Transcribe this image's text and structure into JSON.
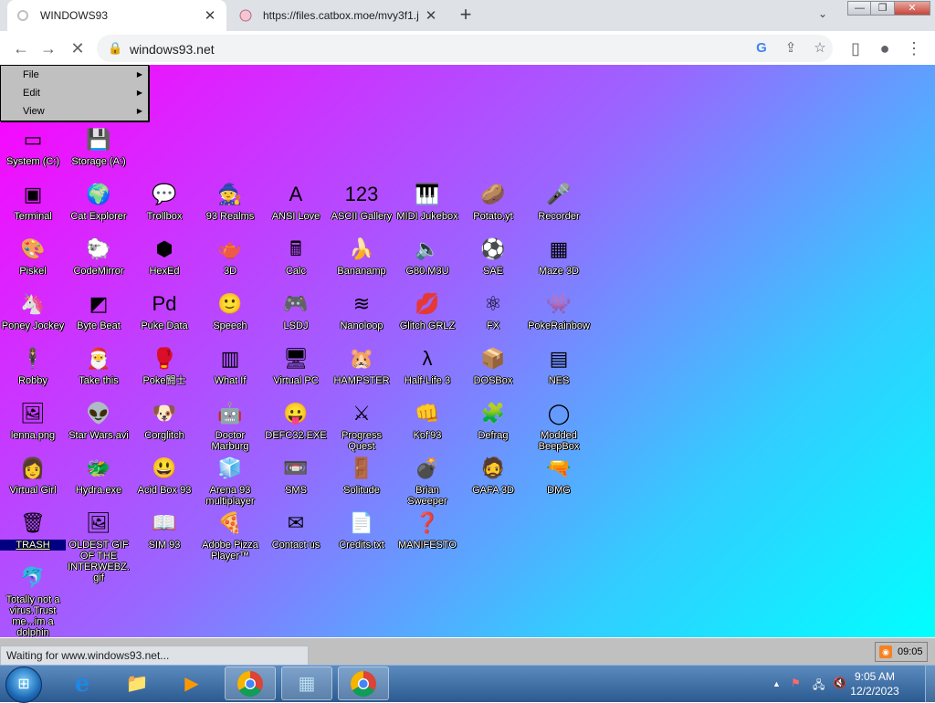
{
  "browser": {
    "tabs": [
      {
        "title": "WINDOWS93",
        "active": true
      },
      {
        "title": "https://files.catbox.moe/mvy3f1.j",
        "active": false
      }
    ],
    "new_tab": "+",
    "tab_search": "⌄",
    "window_controls": {
      "minimize": "—",
      "maximize": "❐",
      "close": "✕"
    },
    "url": "windows93.net",
    "status_text": "Waiting for www.windows93.net..."
  },
  "w93": {
    "menu": [
      {
        "label": "File",
        "arrow": "▶"
      },
      {
        "label": "Edit",
        "arrow": "▶"
      },
      {
        "label": "View",
        "arrow": "▶"
      }
    ],
    "clock": "09:05",
    "icons": [
      {
        "label": "System (C:)",
        "glyph": "▭",
        "col": 0,
        "row": 0
      },
      {
        "label": "Storage (A:)",
        "glyph": "💾",
        "col": 1,
        "row": 0
      },
      {
        "label": "Terminal",
        "glyph": "▣",
        "col": 0,
        "row": 1
      },
      {
        "label": "Cat Explorer",
        "glyph": "🌍",
        "col": 1,
        "row": 1
      },
      {
        "label": "Trollbox",
        "glyph": "💬",
        "col": 2,
        "row": 1
      },
      {
        "label": "93 Realms",
        "glyph": "🧙",
        "col": 3,
        "row": 1
      },
      {
        "label": "ANSI Love",
        "glyph": "A",
        "col": 4,
        "row": 1
      },
      {
        "label": "ASCII Gallery",
        "glyph": "123",
        "col": 5,
        "row": 1
      },
      {
        "label": "MIDI Jukebox",
        "glyph": "🎹",
        "col": 6,
        "row": 1
      },
      {
        "label": "Potato.yt",
        "glyph": "🥔",
        "col": 7,
        "row": 1
      },
      {
        "label": "Recorder",
        "glyph": "🎤",
        "col": 8,
        "row": 1
      },
      {
        "label": "Piskel",
        "glyph": "🎨",
        "col": 0,
        "row": 2
      },
      {
        "label": "CodeMirror",
        "glyph": "🐑",
        "col": 1,
        "row": 2
      },
      {
        "label": "HexEd",
        "glyph": "⬢",
        "col": 2,
        "row": 2
      },
      {
        "label": "3D",
        "glyph": "🫖",
        "col": 3,
        "row": 2
      },
      {
        "label": "Calc",
        "glyph": "🖩",
        "col": 4,
        "row": 2
      },
      {
        "label": "Bananamp",
        "glyph": "🍌",
        "col": 5,
        "row": 2
      },
      {
        "label": "G80.M3U",
        "glyph": "🔈",
        "col": 6,
        "row": 2
      },
      {
        "label": "SAE",
        "glyph": "⚽",
        "col": 7,
        "row": 2
      },
      {
        "label": "Maze 3D",
        "glyph": "▦",
        "col": 8,
        "row": 2
      },
      {
        "label": "Poney Jockey",
        "glyph": "🦄",
        "col": 0,
        "row": 3
      },
      {
        "label": "Byte Beat",
        "glyph": "◩",
        "col": 1,
        "row": 3
      },
      {
        "label": "Puke Data",
        "glyph": "Pd",
        "col": 2,
        "row": 3
      },
      {
        "label": "Speech",
        "glyph": "🙂",
        "col": 3,
        "row": 3
      },
      {
        "label": "LSDJ",
        "glyph": "🎮",
        "col": 4,
        "row": 3
      },
      {
        "label": "Nanoloop",
        "glyph": "≋",
        "col": 5,
        "row": 3
      },
      {
        "label": "Glitch GRLZ",
        "glyph": "💋",
        "col": 6,
        "row": 3
      },
      {
        "label": "FX",
        "glyph": "⚛",
        "col": 7,
        "row": 3
      },
      {
        "label": "PokeRainbow",
        "glyph": "👾",
        "col": 8,
        "row": 3
      },
      {
        "label": "Robby",
        "glyph": "🕴",
        "col": 0,
        "row": 4
      },
      {
        "label": "Take this",
        "glyph": "🎅",
        "col": 1,
        "row": 4
      },
      {
        "label": "Poke闘士",
        "glyph": "🥊",
        "col": 2,
        "row": 4
      },
      {
        "label": "What If",
        "glyph": "▥",
        "col": 3,
        "row": 4
      },
      {
        "label": "Virtual PC",
        "glyph": "🖥",
        "col": 4,
        "row": 4
      },
      {
        "label": "HAMPSTER",
        "glyph": "🐹",
        "col": 5,
        "row": 4
      },
      {
        "label": "Half-Life 3",
        "glyph": "λ",
        "col": 6,
        "row": 4
      },
      {
        "label": "DOSBox",
        "glyph": "📦",
        "col": 7,
        "row": 4
      },
      {
        "label": "NES",
        "glyph": "▤",
        "col": 8,
        "row": 4
      },
      {
        "label": "lenna.png",
        "glyph": "🖼",
        "col": 0,
        "row": 5
      },
      {
        "label": "Star Wars.avi",
        "glyph": "👽",
        "col": 1,
        "row": 5
      },
      {
        "label": "Corglitch",
        "glyph": "🐶",
        "col": 2,
        "row": 5
      },
      {
        "label": "Doctor Marburg",
        "glyph": "🤖",
        "col": 3,
        "row": 5
      },
      {
        "label": "DEFC32.EXE",
        "glyph": "😛",
        "col": 4,
        "row": 5
      },
      {
        "label": "Progress Quest",
        "glyph": "⚔",
        "col": 5,
        "row": 5
      },
      {
        "label": "Kof'93",
        "glyph": "👊",
        "col": 6,
        "row": 5
      },
      {
        "label": "Defrag",
        "glyph": "🧩",
        "col": 7,
        "row": 5
      },
      {
        "label": "Modded BeepBox",
        "glyph": "◯",
        "col": 8,
        "row": 5
      },
      {
        "label": "Virtual Girl",
        "glyph": "👩",
        "col": 0,
        "row": 6
      },
      {
        "label": "Hydra.exe",
        "glyph": "🐲",
        "col": 1,
        "row": 6
      },
      {
        "label": "Acid Box 93",
        "glyph": "😃",
        "col": 2,
        "row": 6
      },
      {
        "label": "Arena 93 multiplayer",
        "glyph": "🧊",
        "col": 3,
        "row": 6
      },
      {
        "label": "SMS",
        "glyph": "📼",
        "col": 4,
        "row": 6
      },
      {
        "label": "Solitude",
        "glyph": "🚪",
        "col": 5,
        "row": 6
      },
      {
        "label": "Brian Sweeper",
        "glyph": "💣",
        "col": 6,
        "row": 6
      },
      {
        "label": "GAFA 3D",
        "glyph": "🧔",
        "col": 7,
        "row": 6
      },
      {
        "label": "DMG",
        "glyph": "🔫",
        "col": 8,
        "row": 6
      },
      {
        "label": "TRASH",
        "glyph": "🗑",
        "col": 0,
        "row": 7,
        "selected": true
      },
      {
        "label": "OLDEST GIF OF THE INTERWEBZ.gif",
        "glyph": "🖼",
        "col": 1,
        "row": 7
      },
      {
        "label": "SIM 93",
        "glyph": "📖",
        "col": 2,
        "row": 7
      },
      {
        "label": "Adobe Pizza Player™",
        "glyph": "🍕",
        "col": 3,
        "row": 7
      },
      {
        "label": "Contact us",
        "glyph": "✉",
        "col": 4,
        "row": 7
      },
      {
        "label": "Credits.txt",
        "glyph": "📄",
        "col": 5,
        "row": 7
      },
      {
        "label": "MANIFESTO",
        "glyph": "❓",
        "col": 6,
        "row": 7
      },
      {
        "label": "Totally not a virus.Trust me...im a dolphin",
        "glyph": "🐬",
        "col": 0,
        "row": 8
      }
    ]
  },
  "taskbar": {
    "start": "⊞",
    "pinned": [
      {
        "name": "ie",
        "glyph": "e"
      },
      {
        "name": "explorer",
        "glyph": "📁"
      },
      {
        "name": "media",
        "glyph": "▶"
      },
      {
        "name": "chrome",
        "glyph": "◉"
      },
      {
        "name": "app",
        "glyph": "▦"
      },
      {
        "name": "chrome2",
        "glyph": "◉"
      }
    ],
    "tray": {
      "chevron": "▲",
      "flag": "⚑",
      "network": "🖧",
      "volume": "🔇"
    },
    "time": "9:05 AM",
    "date": "12/2/2023"
  }
}
